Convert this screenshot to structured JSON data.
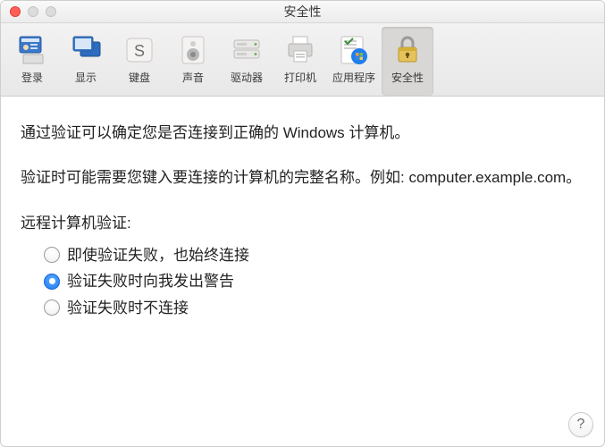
{
  "window": {
    "title": "安全性"
  },
  "toolbar": {
    "items": [
      {
        "key": "login",
        "label": "登录"
      },
      {
        "key": "display",
        "label": "显示"
      },
      {
        "key": "keyboard",
        "label": "键盘"
      },
      {
        "key": "sound",
        "label": "声音"
      },
      {
        "key": "drives",
        "label": "驱动器"
      },
      {
        "key": "printers",
        "label": "打印机"
      },
      {
        "key": "apps",
        "label": "应用程序"
      },
      {
        "key": "security",
        "label": "安全性"
      }
    ],
    "selected_key": "security"
  },
  "content": {
    "paragraph1": "通过验证可以确定您是否连接到正确的 Windows 计算机。",
    "paragraph2": "验证时可能需要您键入要连接的计算机的完整名称。例如: computer.example.com。",
    "section_label": "远程计算机验证:",
    "radio_options": [
      {
        "key": "always",
        "label": "即使验证失败，也始终连接"
      },
      {
        "key": "warn",
        "label": "验证失败时向我发出警告"
      },
      {
        "key": "never",
        "label": "验证失败时不连接"
      }
    ],
    "radio_selected": "warn"
  },
  "help_button": {
    "label": "?"
  }
}
